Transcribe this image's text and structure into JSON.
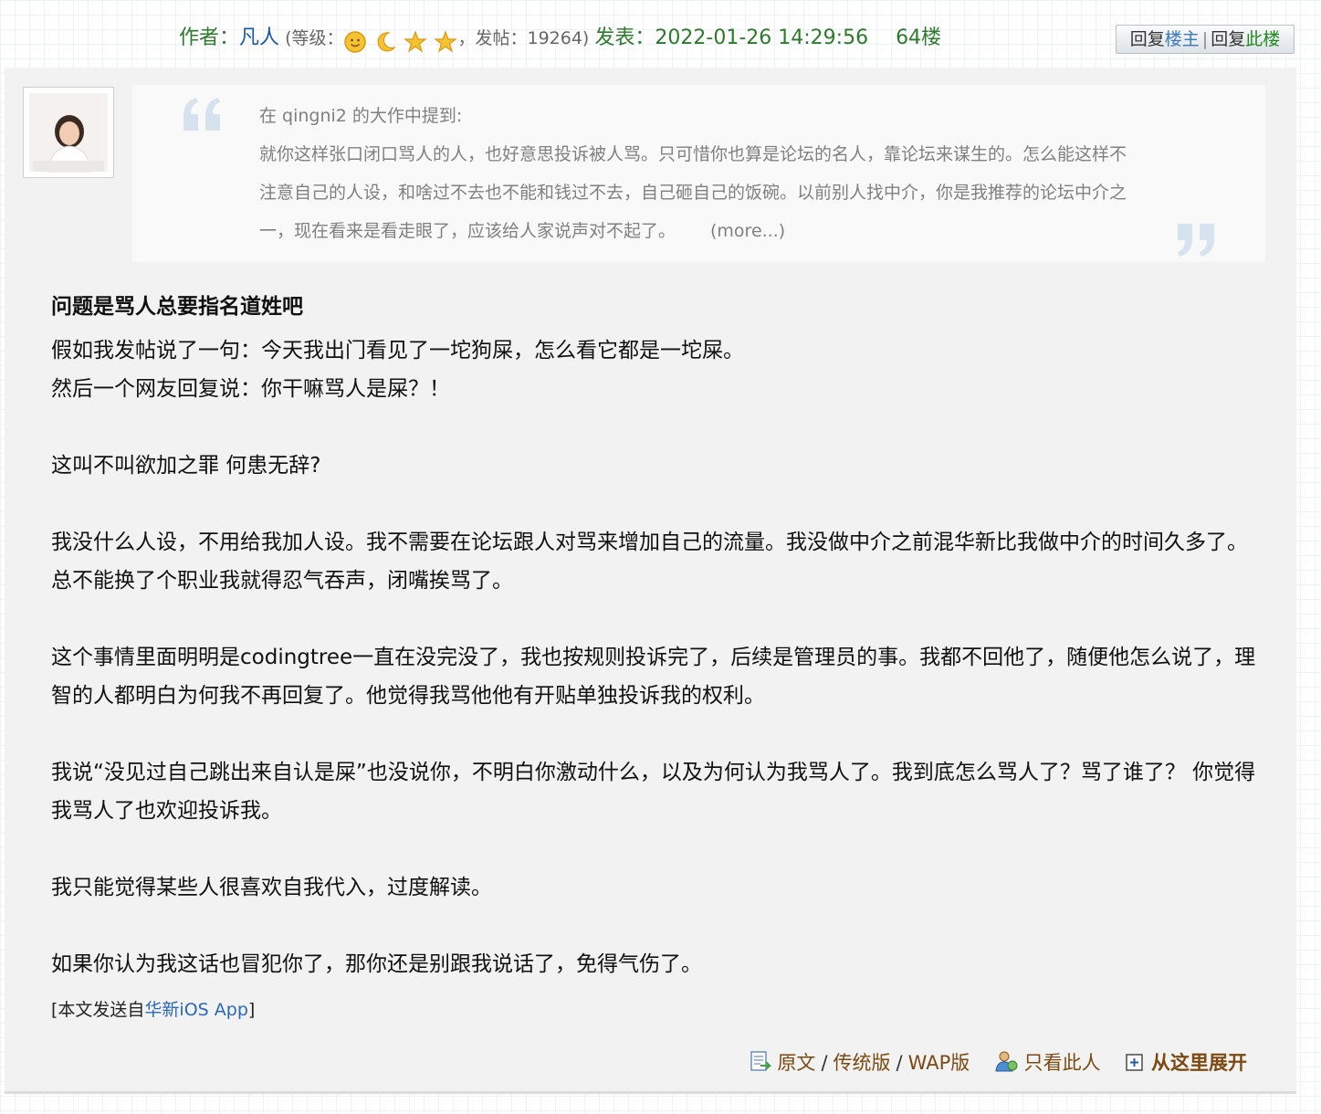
{
  "header": {
    "author_label": "作者：",
    "author_name": "凡人",
    "level_open": " (等级：",
    "level_icons": [
      "sun-icon",
      "moon-icon",
      "star-icon",
      "star-icon"
    ],
    "post_count_label": "，发帖：19264) ",
    "posted_label": "发表：",
    "posted_time": "2022-01-26 14:29:56",
    "floor": "64楼"
  },
  "reply_box": {
    "reply_prefix_1": "回复",
    "reply_target_1": "楼主",
    "separator": "|",
    "reply_prefix_2": "回复",
    "reply_target_2": "此楼"
  },
  "quote": {
    "intro": "在 qingni2 的大作中提到:",
    "text": "就你这样张口闭口骂人的人，也好意思投诉被人骂。只可惜你也算是论坛的名人，靠论坛来谋生的。怎么能这样不注意自己的人设，和啥过不去也不能和钱过不去，自己砸自己的饭碗。以前别人找中介，你是我推荐的论坛中介之一，现在看来是看走眼了，应该给人家说声对不起了。",
    "more": "(more...)"
  },
  "body": {
    "title": "问题是骂人总要指名道姓吧",
    "p1a": "假如我发帖说了一句：今天我出门看见了一坨狗屎，怎么看它都是一坨屎。",
    "p1b": "然后一个网友回复说：你干嘛骂人是屎？！",
    "p2": "这叫不叫欲加之罪 何患无辞?",
    "p3": "我没什么人设，不用给我加人设。我不需要在论坛跟人对骂来增加自己的流量。我没做中介之前混华新比我做中介的时间久多了。总不能换了个职业我就得忍气吞声，闭嘴挨骂了。",
    "p4": "这个事情里面明明是codingtree一直在没完没了，我也按规则投诉完了，后续是管理员的事。我都不回他了，随便他怎么说了，理智的人都明白为何我不再回复了。他觉得我骂他他有开贴单独投诉我的权利。",
    "p5": "我说“没见过自己跳出来自认是屎”也没说你，不明白你激动什么，以及为何认为我骂人了。我到底怎么骂人了？骂了谁了？ 你觉得我骂人了也欢迎投诉我。",
    "p6": "我只能觉得某些人很喜欢自我代入，过度解读。",
    "p7": "如果你认为我这话也冒犯你了，那你还是别跟我说话了，免得气伤了。"
  },
  "source": {
    "prefix": "[本文发送自",
    "app": "华新iOS App",
    "suffix": "]"
  },
  "footer": {
    "original": "原文",
    "slash": "/",
    "classic": "传统版",
    "wap": "WAP版",
    "only_this_user": "只看此人",
    "expand_from_here": "从这里展开"
  },
  "colors": {
    "green": "#2c7a2c",
    "name_blue": "#1a56b0",
    "link_brown": "#7b4a12",
    "post_bg": "#f2f2f2",
    "quote_bg": "#f9f9f9"
  }
}
